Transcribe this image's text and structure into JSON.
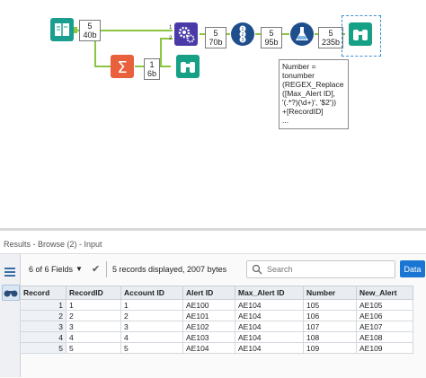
{
  "workflow": {
    "badges": {
      "input_output": {
        "count": "5",
        "size": "40b"
      },
      "summarize_output": {
        "count": "1",
        "size": "6b"
      },
      "formula_output": {
        "count": "5",
        "size": "70b"
      },
      "recordid_output": {
        "count": "5",
        "size": "95b"
      },
      "formula2_output": {
        "count": "5",
        "size": "235b"
      }
    },
    "annotation": {
      "lines": [
        "Number =",
        "tonumber",
        "(REGEX_Replace",
        "([Max_Alert ID],",
        "'(.*?)(\\d+)', '$2'))",
        "+[RecordID]",
        "..."
      ]
    },
    "anchor_labels": {
      "join_top": "1",
      "join_bottom": "2"
    },
    "colors": {
      "input_tool": "#1a9e8f",
      "summarize_tool": "#e8603c",
      "browse_tool": "#16a085",
      "formula_tool": "#4a3aa8",
      "recordid_tool": "#1f4e8c",
      "formula2_tool": "#1f4e8c",
      "connector": "#8ac63f"
    }
  },
  "results": {
    "header_title": "Results - Browse (2) - Input",
    "fields_label": "6 of 6 Fields",
    "records_text": "5 records displayed, 2007 bytes",
    "search_placeholder": "Search",
    "data_button": "Data",
    "columns": [
      "Record",
      "RecordID",
      "Account ID",
      "Alert ID",
      "Max_Alert ID",
      "Number",
      "New_Alert"
    ],
    "rows": [
      [
        "1",
        "1",
        "1",
        "AE100",
        "AE104",
        "105",
        "AE105"
      ],
      [
        "2",
        "2",
        "2",
        "AE101",
        "AE104",
        "106",
        "AE106"
      ],
      [
        "3",
        "3",
        "3",
        "AE102",
        "AE104",
        "107",
        "AE107"
      ],
      [
        "4",
        "4",
        "4",
        "AE103",
        "AE104",
        "108",
        "AE108"
      ],
      [
        "5",
        "5",
        "5",
        "AE104",
        "AE104",
        "109",
        "AE109"
      ]
    ]
  }
}
